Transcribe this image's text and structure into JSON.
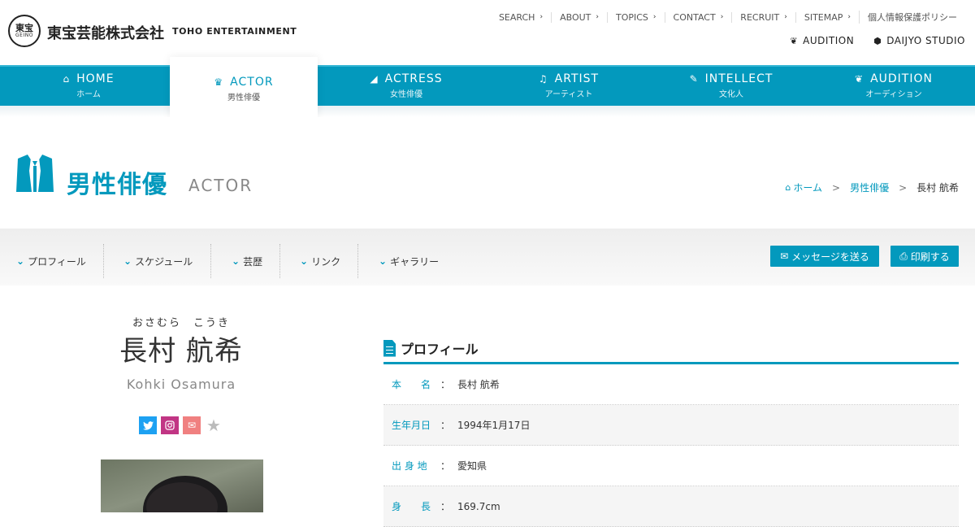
{
  "header": {
    "logo_mark_kanji": "東宝",
    "logo_mark_sub": "GEINO",
    "logo_jp": "東宝芸能株式会社",
    "logo_en": "TOHO ENTERTAINMENT",
    "util_links": [
      "SEARCH",
      "ABOUT",
      "TOPICS",
      "CONTACT",
      "RECRUIT",
      "SITEMAP",
      "個人情報保護ポリシー"
    ],
    "audition_link": "AUDITION",
    "daijyo_link": "DAIJYO STUDIO"
  },
  "nav": {
    "items": [
      {
        "label": "HOME",
        "sub": "ホーム",
        "icon": "home-icon"
      },
      {
        "label": "ACTOR",
        "sub": "男性俳優",
        "icon": "actor-icon",
        "active": true
      },
      {
        "label": "ACTRESS",
        "sub": "女性俳優",
        "icon": "actress-icon"
      },
      {
        "label": "ARTIST",
        "sub": "アーティスト",
        "icon": "music-note-icon"
      },
      {
        "label": "INTELLECT",
        "sub": "文化人",
        "icon": "pencil-icon"
      },
      {
        "label": "AUDITION",
        "sub": "オーディション",
        "icon": "leaf-icon"
      }
    ]
  },
  "page": {
    "title_jp": "男性俳優",
    "title_en": "ACTOR"
  },
  "breadcrumb": {
    "home": "ホーム",
    "section": "男性俳優",
    "current": "長村 航希",
    "separator": ">"
  },
  "subtabs": [
    "プロフィール",
    "スケジュール",
    "芸歴",
    "リンク",
    "ギャラリー"
  ],
  "buttons": {
    "message": "メッセージを送る",
    "print": "印刷する"
  },
  "profile": {
    "kana": "おさむら　こうき",
    "name": "長村 航希",
    "roman": "Kohki Osamura",
    "section_title": "プロフィール",
    "rows": [
      {
        "key": "本　　名",
        "value": "長村 航希"
      },
      {
        "key": "生年月日",
        "value": "1994年1月17日"
      },
      {
        "key": "出 身 地",
        "value": "愛知県"
      },
      {
        "key": "身　　長",
        "value": "169.7cm"
      }
    ],
    "colon": "："
  },
  "colors": {
    "brand": "#0399bd",
    "twitter": "#1da1f2",
    "instagram": "#c13584",
    "mail": "#f08080"
  }
}
